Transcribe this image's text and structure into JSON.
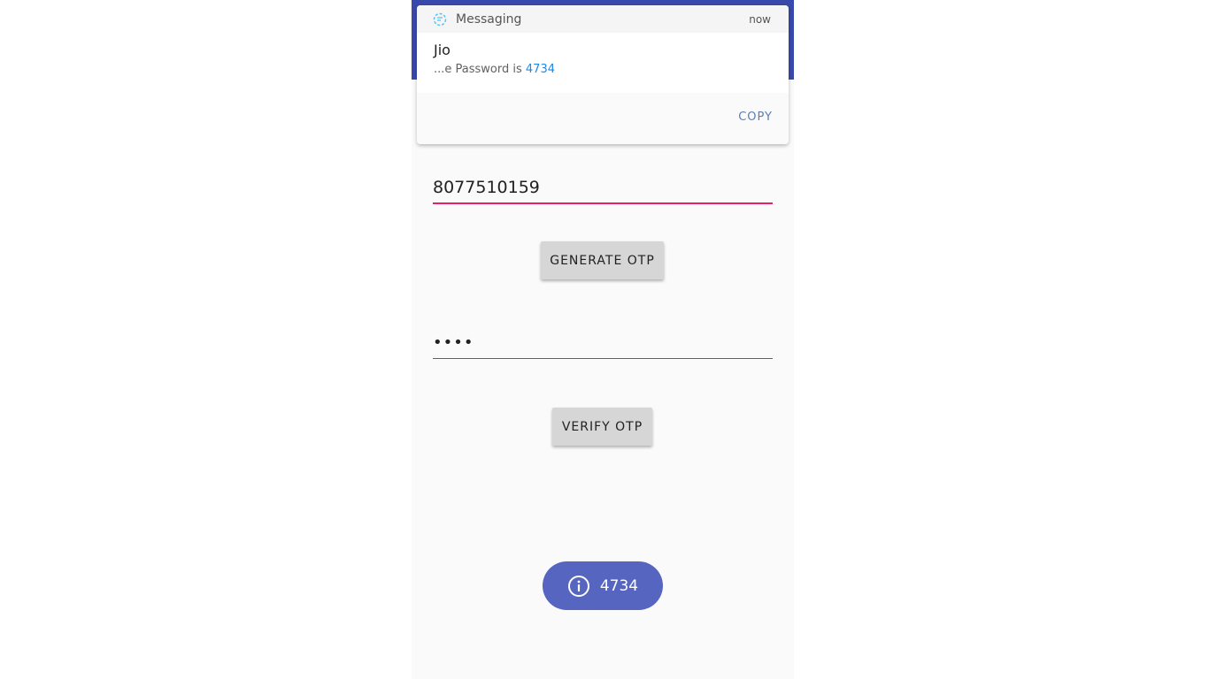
{
  "colors": {
    "appbar": "#3949ab",
    "accent": "#e91e63",
    "toast_bg": "#5565c0",
    "otp_highlight": "#1e88e5"
  },
  "notification": {
    "app_icon": "messaging-icon",
    "app_name": "Messaging",
    "time": "now",
    "title": "Jio",
    "text_prefix": "...e Password is ",
    "otp_code": "4734",
    "action_label": "COPY"
  },
  "form": {
    "phone_value": "8077510159",
    "generate_label": "GENERATE OTP",
    "otp_value": "••••",
    "verify_label": "VERIFY OTP"
  },
  "toast": {
    "icon": "info-icon",
    "text": "4734"
  }
}
